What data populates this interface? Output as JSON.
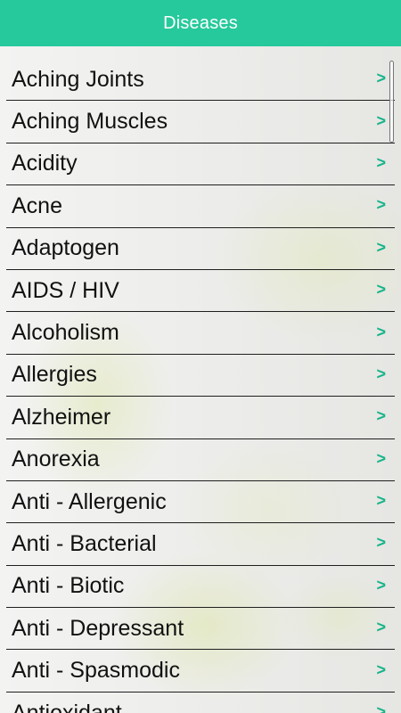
{
  "header": {
    "title": "Diseases"
  },
  "items": [
    {
      "label": "Aching Joints"
    },
    {
      "label": "Aching Muscles"
    },
    {
      "label": "Acidity"
    },
    {
      "label": "Acne"
    },
    {
      "label": "Adaptogen"
    },
    {
      "label": "AIDS / HIV"
    },
    {
      "label": "Alcoholism"
    },
    {
      "label": "Allergies"
    },
    {
      "label": "Alzheimer"
    },
    {
      "label": "Anorexia"
    },
    {
      "label": "Anti - Allergenic"
    },
    {
      "label": "Anti - Bacterial"
    },
    {
      "label": "Anti - Biotic"
    },
    {
      "label": "Anti - Depressant"
    },
    {
      "label": "Anti - Spasmodic"
    },
    {
      "label": "Antioxidant"
    }
  ],
  "chevron_glyph": ">",
  "colors": {
    "accent": "#26c99b",
    "chevron": "#14b489"
  }
}
